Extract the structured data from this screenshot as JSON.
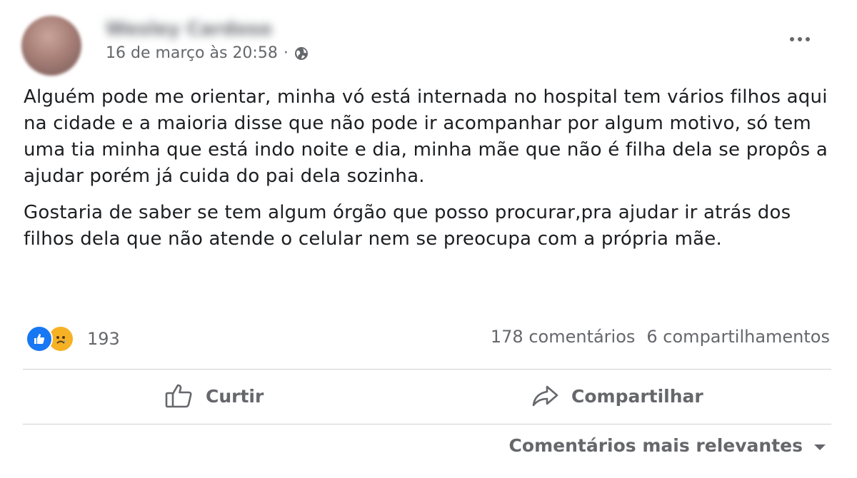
{
  "post": {
    "author_name": "Wesley Cardoso",
    "timestamp": "16 de março às 20:58",
    "meta_separator": "·",
    "privacy_icon": "globe-icon",
    "paragraphs": [
      "Alguém pode me orientar, minha vó está internada no hospital tem vários filhos aqui na cidade e a maioria disse que não pode ir acompanhar por algum motivo, só tem uma tia minha que está indo noite e dia, minha mãe que não é filha dela se propôs a ajudar porém já cuida do pai dela sozinha.",
      "Gostaria de saber se tem algum órgão que posso procurar,pra ajudar ir atrás dos filhos dela que não atende o celular nem se preocupa com a própria mãe."
    ]
  },
  "stats": {
    "reaction_count": "193",
    "comments": "178 comentários",
    "shares": "6 compartilhamentos"
  },
  "actions": {
    "like_label": "Curtir",
    "share_label": "Compartilhar"
  },
  "comments": {
    "sort_label": "Comentários mais relevantes"
  },
  "colors": {
    "like_blue": "#1877f2",
    "sad_yellow": "#f7b125",
    "secondary_text": "#65676b",
    "divider": "#ced0d4"
  }
}
